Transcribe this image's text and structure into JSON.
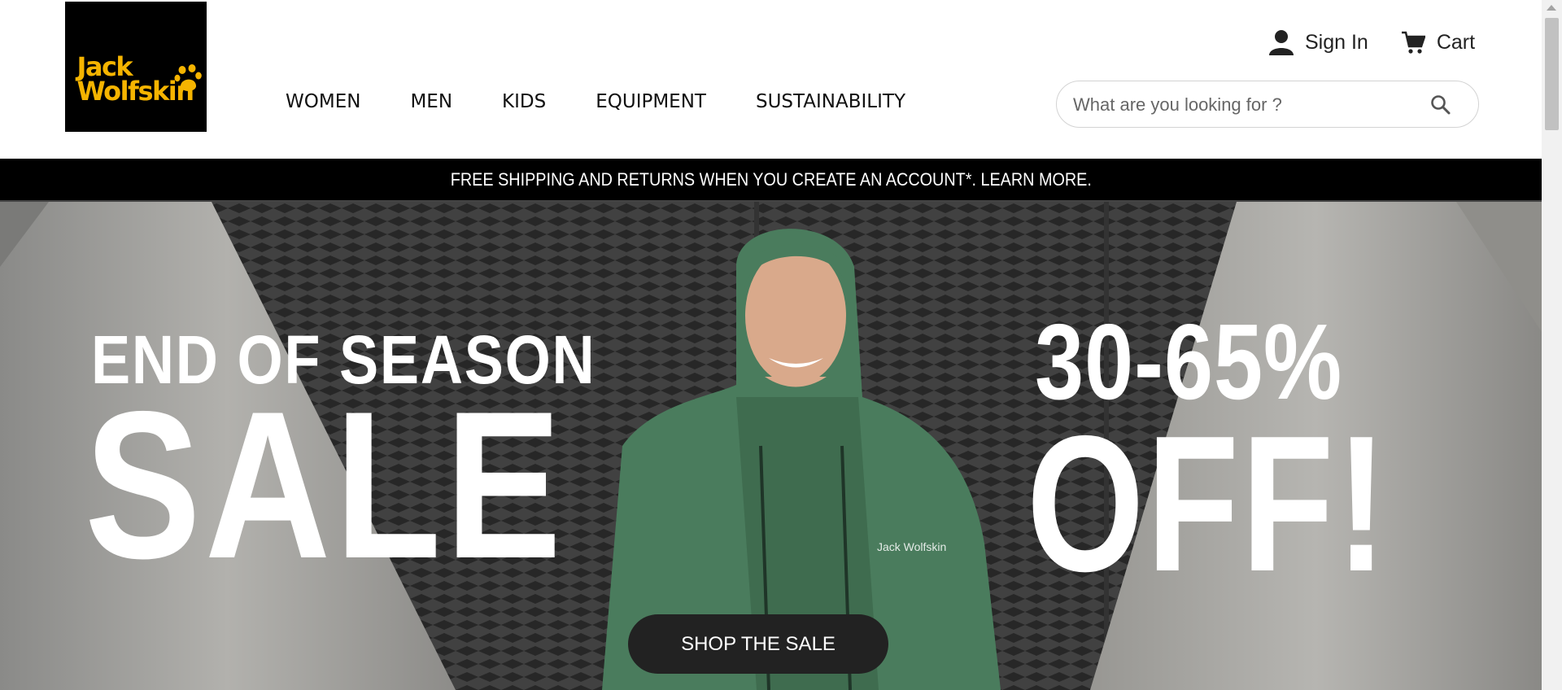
{
  "brand": {
    "logo_line1": "Jack",
    "logo_line2": "Wolfskin",
    "logo_bg": "#000000",
    "logo_color": "#f5b400"
  },
  "nav": {
    "items": [
      "WOMEN",
      "MEN",
      "KIDS",
      "EQUIPMENT",
      "SUSTAINABILITY"
    ]
  },
  "account": {
    "sign_in_label": "Sign In",
    "sign_in_icon": "user-icon",
    "cart_label": "Cart",
    "cart_icon": "cart-icon"
  },
  "search": {
    "placeholder": "What are you looking for ?",
    "value": "",
    "icon": "search-icon"
  },
  "promo_bar": {
    "text": "FREE SHIPPING AND RETURNS WHEN YOU CREATE AN ACCOUNT*. LEARN MORE."
  },
  "hero": {
    "line1": "END OF SEASON",
    "line2": "SALE",
    "discount": "30-65%",
    "discount_suffix": "OFF!",
    "cta_label": "SHOP THE SALE",
    "jacket_logo_text": "Jack Wolfskin",
    "jacket_color": "#4a7c5d"
  }
}
